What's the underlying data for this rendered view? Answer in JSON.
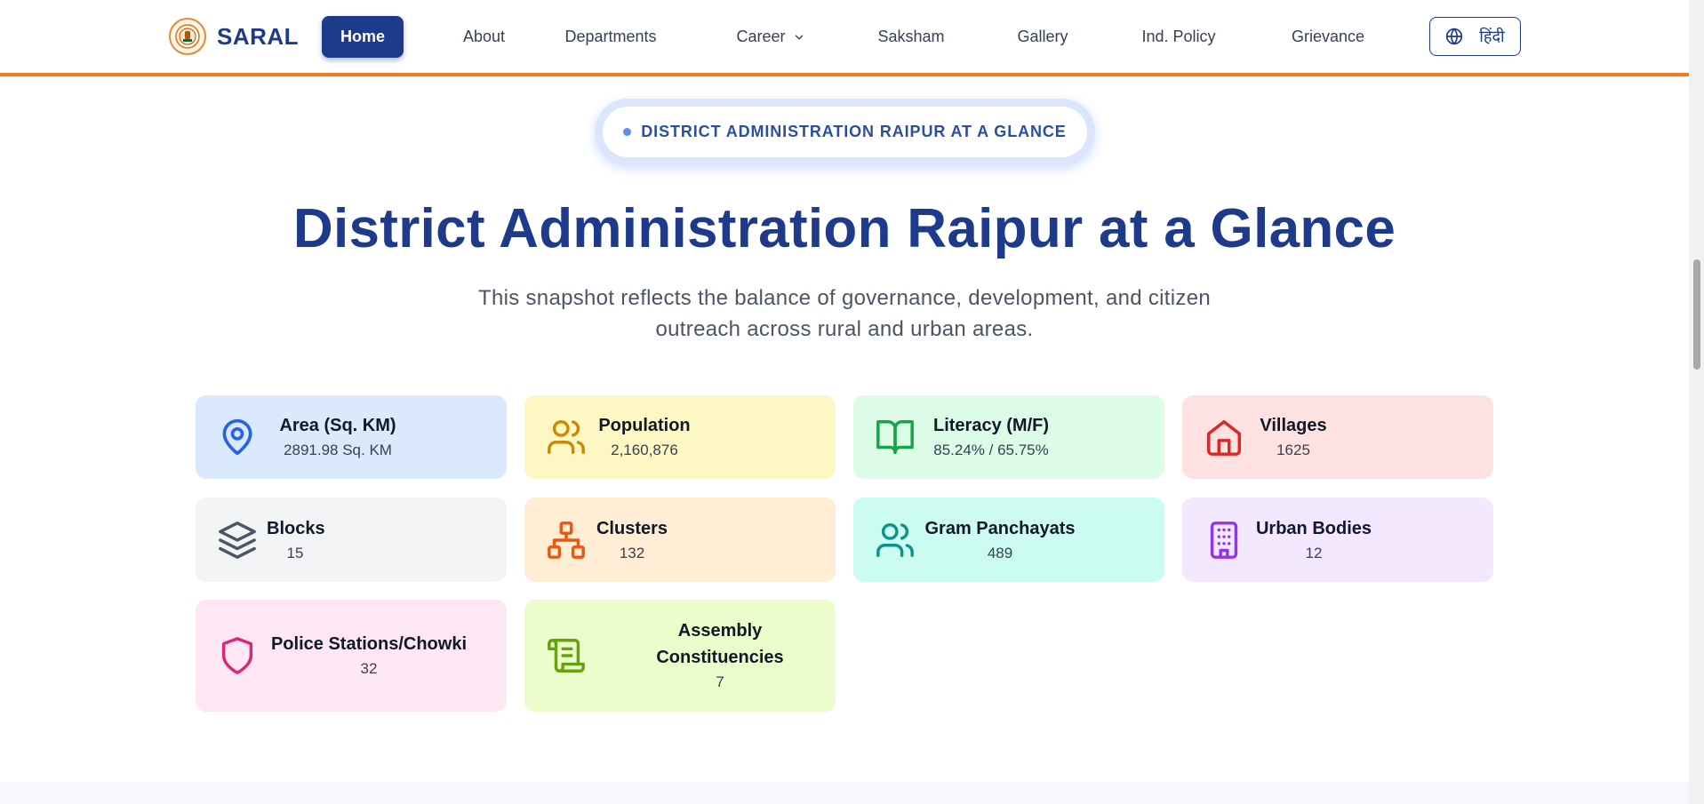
{
  "header": {
    "brand": "SARAL",
    "nav": [
      {
        "label": "Home",
        "active": true
      },
      {
        "label": "About"
      },
      {
        "label": "Departments"
      },
      {
        "label": "Career",
        "has_dropdown": true
      },
      {
        "label": "Saksham"
      },
      {
        "label": "Gallery"
      },
      {
        "label": "Ind. Policy"
      },
      {
        "label": "Grievance"
      }
    ],
    "language_button": "हिंदी",
    "accent_color": "#f07b1d",
    "brand_color": "#1e3a8a"
  },
  "hero": {
    "badge": "DISTRICT ADMINISTRATION RAIPUR AT A GLANCE",
    "title": "District Administration Raipur at a Glance",
    "subtitle_line1": "This snapshot reflects the balance of governance, development, and citizen",
    "subtitle_line2": "outreach across rural and urban areas."
  },
  "stats": [
    {
      "label": "Area (Sq. KM)",
      "value": "2891.98 Sq. KM",
      "icon": "map-pin-icon",
      "bg": "#dbe9fd",
      "icon_color": "#2563eb"
    },
    {
      "label": "Population",
      "value": "2,160,876",
      "icon": "users-icon",
      "bg": "#fdf7c3",
      "icon_color": "#ca8a04"
    },
    {
      "label": "Literacy (M/F)",
      "value": "85.24% / 65.75%",
      "icon": "book-open-icon",
      "bg": "#dcfce7",
      "icon_color": "#16a34a"
    },
    {
      "label": "Villages",
      "value": "1625",
      "icon": "home-icon",
      "bg": "#fee2e2",
      "icon_color": "#dc2626"
    },
    {
      "label": "Blocks",
      "value": "15",
      "icon": "layers-icon",
      "bg": "#f3f4f6",
      "icon_color": "#4b5563"
    },
    {
      "label": "Clusters",
      "value": "132",
      "icon": "network-icon",
      "bg": "#ffedd5",
      "icon_color": "#ea580c"
    },
    {
      "label": "Gram Panchayats",
      "value": "489",
      "icon": "users-icon",
      "bg": "#ccfbf1",
      "icon_color": "#0d9488"
    },
    {
      "label": "Urban Bodies",
      "value": "12",
      "icon": "building-icon",
      "bg": "#f3e8ff",
      "icon_color": "#9333ea"
    },
    {
      "label": "Police Stations/Chowki",
      "value": "32",
      "icon": "shield-icon",
      "bg": "#fce7f3",
      "icon_color": "#db2777"
    },
    {
      "label": "Assembly Constituencies",
      "value": "7",
      "icon": "scroll-icon",
      "bg": "#ecfccb",
      "icon_color": "#65a30d"
    }
  ]
}
